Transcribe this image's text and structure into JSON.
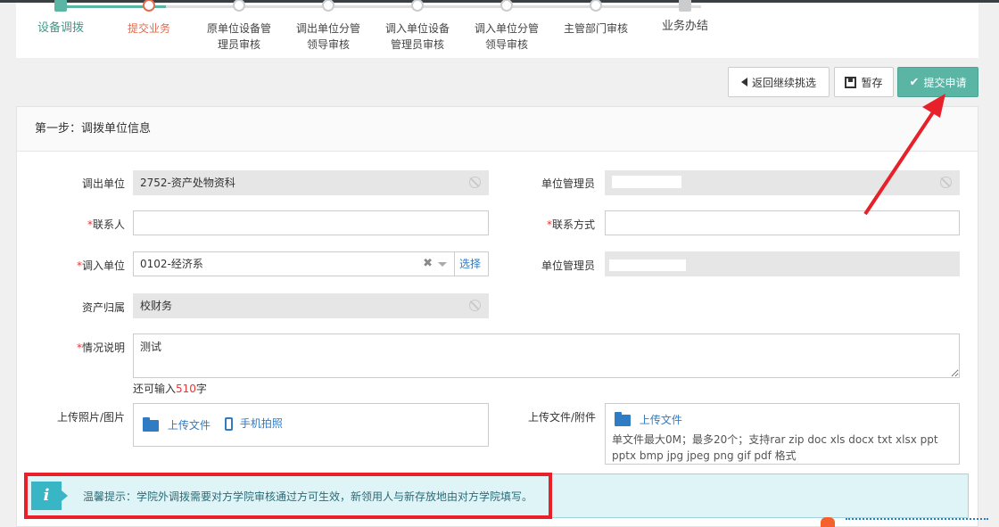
{
  "steps": [
    {
      "label": "设备调拨",
      "status": "done"
    },
    {
      "label": "提交业务",
      "status": "current"
    },
    {
      "label": "原单位设备管\n理员审核",
      "status": "pending"
    },
    {
      "label": "调出单位分管\n领导审核",
      "status": "pending"
    },
    {
      "label": "调入单位设备\n管理员审核",
      "status": "pending"
    },
    {
      "label": "调入单位分管\n领导审核",
      "status": "pending"
    },
    {
      "label": "主管部门审核",
      "status": "pending"
    },
    {
      "label": "业务办结",
      "status": "pending"
    }
  ],
  "toolbar": {
    "back_label": "返回继续挑选",
    "save_label": "暂存",
    "submit_label": "提交申请"
  },
  "panel": {
    "title": "第一步：调拨单位信息"
  },
  "form": {
    "out_unit_label": "调出单位",
    "out_unit_value": "2752-资产处物资科",
    "out_manager_label": "单位管理员",
    "contact_label": "联系人",
    "contact_value": "",
    "contact_phone_label": "联系方式",
    "contact_phone_value": "",
    "in_unit_label": "调入单位",
    "in_unit_value": "0102-经济系",
    "in_unit_select": "选择",
    "in_manager_label": "单位管理员",
    "asset_owner_label": "资产归属",
    "asset_owner_value": "校财务",
    "desc_label": "情况说明",
    "desc_value": "测试",
    "remain_prefix": "还可输入",
    "remain_count": "510",
    "remain_suffix": "字",
    "photo_label": "上传照片/图片",
    "photo_upload": "上传文件",
    "photo_phone": "手机拍照",
    "file_label": "上传文件/附件",
    "file_upload": "上传文件",
    "file_hint": "单文件最大0M；最多20个；支持rar zip doc xls docx txt xlsx ppt pptx bmp jpg jpeg png gif pdf 格式"
  },
  "tip": {
    "icon": "i",
    "text": "温馨提示：学院外调拨需要对方学院审核通过方可生效，新领用人与新存放地由对方学院填写。"
  },
  "colors": {
    "accent": "#5bb5a5",
    "current_step": "#e36b4d",
    "annotation": "#e8202a"
  }
}
